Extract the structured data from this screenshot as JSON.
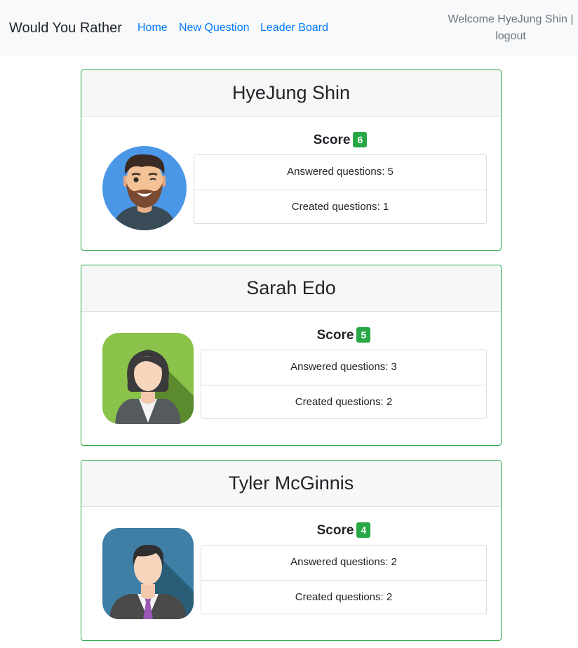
{
  "nav": {
    "brand": "Would You Rather",
    "links": [
      "Home",
      "New Question",
      "Leader Board"
    ],
    "welcome": "Welcome HyeJung Shin |",
    "logout": "logout"
  },
  "leaderboard": [
    {
      "name": "HyeJung Shin",
      "score_label": "Score",
      "score": "6",
      "answered": "Answered questions: 5",
      "created": "Created questions: 1",
      "avatar": "bearded-man-avatar-icon"
    },
    {
      "name": "Sarah Edo",
      "score_label": "Score",
      "score": "5",
      "answered": "Answered questions: 3",
      "created": "Created questions: 2",
      "avatar": "woman-avatar-icon"
    },
    {
      "name": "Tyler McGinnis",
      "score_label": "Score",
      "score": "4",
      "answered": "Answered questions: 2",
      "created": "Created questions: 2",
      "avatar": "man-tie-avatar-icon"
    }
  ],
  "colors": {
    "accent": "#28a745",
    "link": "#007bff",
    "navbar": "#f8f9fa"
  }
}
